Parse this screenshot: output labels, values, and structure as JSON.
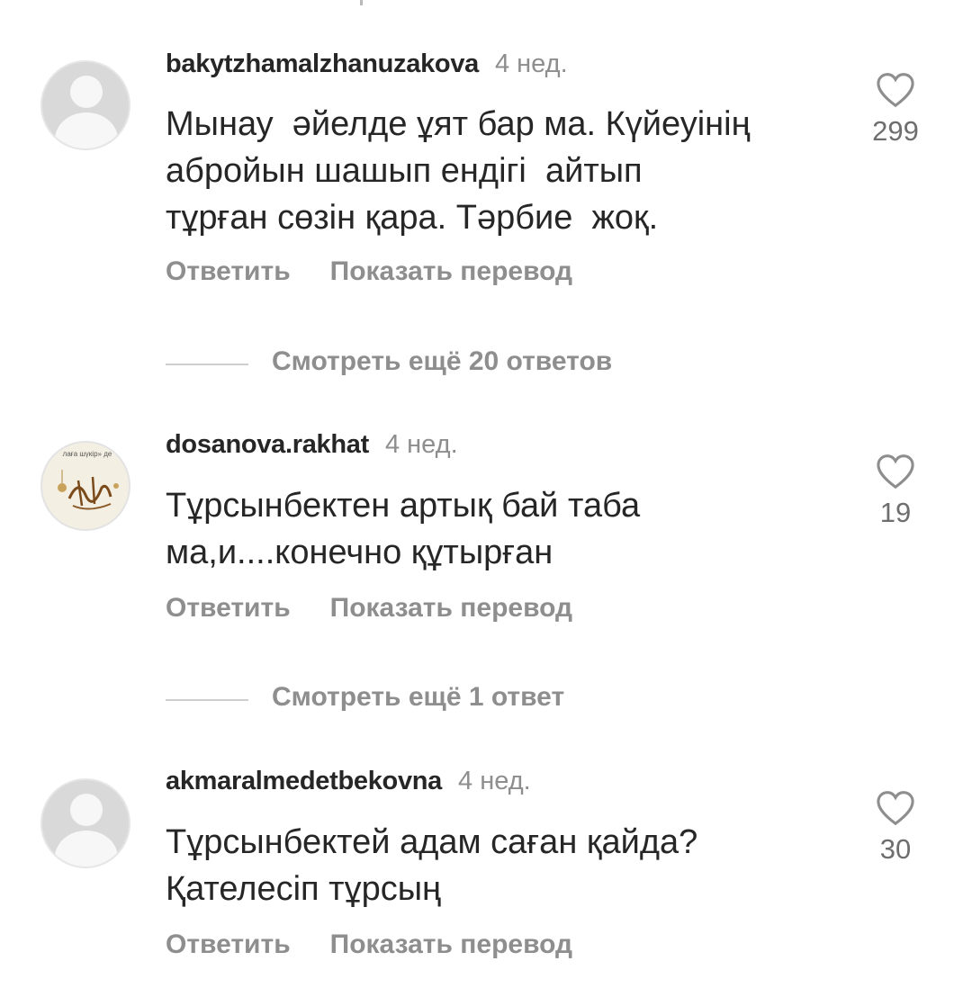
{
  "comments": [
    {
      "username": "bakytzhamalzhanuzakova",
      "age": "4 нед.",
      "text": "Мынау  әйелде ұят бар ма. Күйеуінің\nабройын шашып ендігі  айтып\nтұрған сөзін қара. Тәрбие  жоқ.",
      "likes": "299",
      "reply_label": "Ответить",
      "translate_label": "Показать перевод",
      "avatar_icon": "default-avatar-icon",
      "more_replies": "Смотреть ещё 20 ответов"
    },
    {
      "username": "dosanova.rakhat",
      "age": "4 нед.",
      "text": "Тұрсынбектен артық бай таба\nма,и....конечно құтырған",
      "likes": "19",
      "reply_label": "Ответить",
      "translate_label": "Показать перевод",
      "avatar_icon": "calligraphy-avatar-icon",
      "avatar_band_text": "лаға шүкір» де",
      "more_replies": "Смотреть ещё 1 ответ"
    },
    {
      "username": "akmaralmedetbekovna",
      "age": "4 нед.",
      "text": "Тұрсынбектей адам саған қайда?\nҚателесіп тұрсың",
      "likes": "30",
      "reply_label": "Ответить",
      "translate_label": "Показать перевод",
      "avatar_icon": "default-avatar-icon"
    }
  ],
  "colors": {
    "primary_text": "#262626",
    "secondary_text": "#8e8e8e",
    "divider": "#cfcfcf",
    "avatar_placeholder": "#d9d9d9"
  },
  "icons": {
    "like": "heart-outline-icon"
  }
}
